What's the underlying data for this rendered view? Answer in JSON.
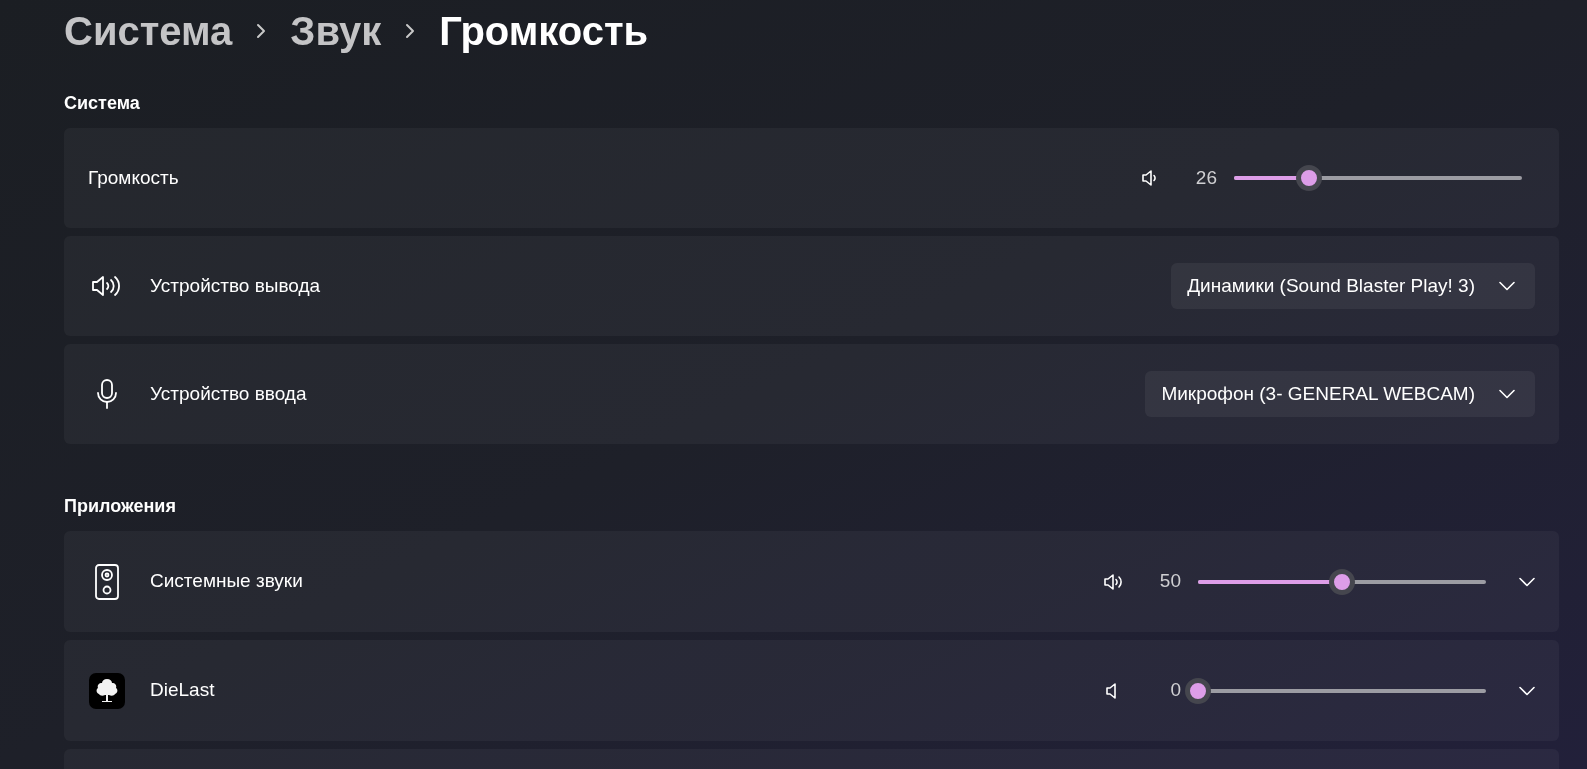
{
  "breadcrumb": [
    "Система",
    "Звук",
    "Громкость"
  ],
  "sections": [
    {
      "title": "Система",
      "rows": [
        {
          "kind": "master-volume",
          "label": "Громкость",
          "reading": "26",
          "level": 0.26
        },
        {
          "kind": "output-device",
          "label": "Устройство вывода",
          "value": "Динамики (Sound Blaster Play! 3)"
        },
        {
          "kind": "input-device",
          "label": "Устройство ввода",
          "value": "Микрофон (3- GENERAL WEBCAM)"
        }
      ]
    },
    {
      "title": "Приложения",
      "rows": [
        {
          "kind": "system-sounds",
          "label": "Системные звуки",
          "reading": "50",
          "level": 0.5
        },
        {
          "kind": "app",
          "label": "DieLast",
          "reading": "0",
          "level": 0
        },
        {
          "kind": "empty"
        }
      ]
    }
  ]
}
